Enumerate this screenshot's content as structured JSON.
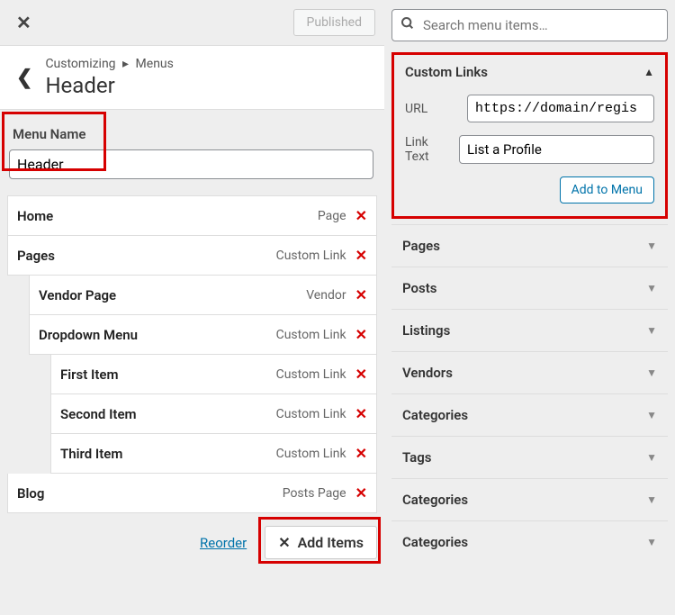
{
  "topbar": {
    "published_label": "Published"
  },
  "header": {
    "crumb_1": "Customizing",
    "crumb_2": "Menus",
    "title": "Header"
  },
  "menu_name": {
    "label": "Menu Name",
    "value": "Header"
  },
  "menu_items": [
    {
      "label": "Home",
      "type": "Page",
      "indent": 0
    },
    {
      "label": "Pages",
      "type": "Custom Link",
      "indent": 0
    },
    {
      "label": "Vendor Page",
      "type": "Vendor",
      "indent": 1
    },
    {
      "label": "Dropdown Menu",
      "type": "Custom Link",
      "indent": 1
    },
    {
      "label": "First Item",
      "type": "Custom Link",
      "indent": 2
    },
    {
      "label": "Second Item",
      "type": "Custom Link",
      "indent": 2
    },
    {
      "label": "Third Item",
      "type": "Custom Link",
      "indent": 2
    },
    {
      "label": "Blog",
      "type": "Posts Page",
      "indent": 0
    }
  ],
  "footer": {
    "reorder": "Reorder",
    "add_items": "Add Items"
  },
  "search": {
    "placeholder": "Search menu items…"
  },
  "custom_links": {
    "title": "Custom Links",
    "url_label": "URL",
    "url_value": "https://domain/regis",
    "text_label": "Link Text",
    "text_value": "List a Profile",
    "add_btn": "Add to Menu"
  },
  "accordion": [
    "Pages",
    "Posts",
    "Listings",
    "Vendors",
    "Categories",
    "Tags",
    "Categories",
    "Categories"
  ]
}
